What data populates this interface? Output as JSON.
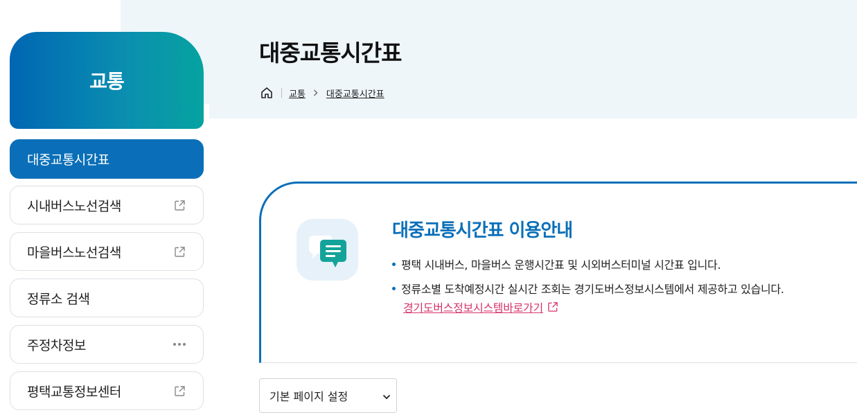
{
  "header": {
    "title": "대중교통시간표",
    "breadcrumb": [
      "교통",
      "대중교통시간표"
    ]
  },
  "sidebar": {
    "section_title": "교통",
    "items": [
      {
        "label": "대중교통시간표",
        "active": true,
        "icon": null
      },
      {
        "label": "시내버스노선검색",
        "active": false,
        "icon": "external-link-icon"
      },
      {
        "label": "마을버스노선검색",
        "active": false,
        "icon": "external-link-icon"
      },
      {
        "label": "정류소 검색",
        "active": false,
        "icon": null
      },
      {
        "label": "주정차정보",
        "active": false,
        "icon": "more-dots-icon"
      },
      {
        "label": "평택교통정보센터",
        "active": false,
        "icon": "external-link-icon"
      }
    ]
  },
  "guide": {
    "title": "대중교통시간표 이용안내",
    "bullets": [
      "평택 시내버스, 마을버스 운행시간표 및 시외버스터미널 시간표 입니다.",
      "정류소별 도착예정시간 실시간 조회는 경기도버스정보시스템에서 제공하고 있습니다."
    ],
    "link_label": "경기도버스정보시스템바로가기"
  },
  "page_select": {
    "selected": "기본 페이지 설정"
  },
  "colors": {
    "primary": "#0a6fb8",
    "gradient_start": "#0066b3",
    "gradient_end": "#06a3a0",
    "link": "#d6336c",
    "hero_bg": "#eef6fa"
  }
}
